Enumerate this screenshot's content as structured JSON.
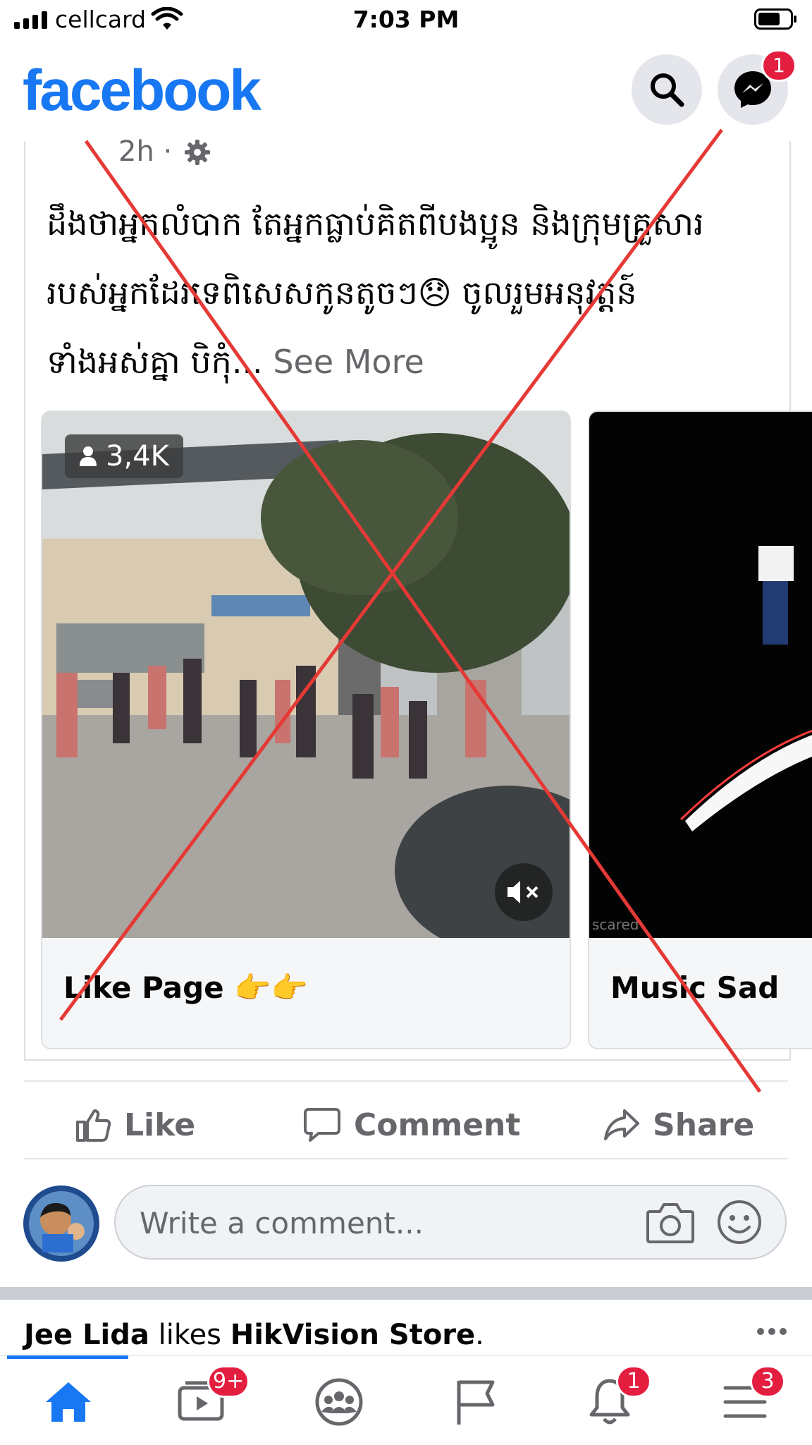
{
  "status_bar": {
    "carrier": "cellcard",
    "time": "7:03 PM"
  },
  "header": {
    "logo": "facebook",
    "messenger_badge": "1"
  },
  "post": {
    "time": "2h ·",
    "text_lines": [
      "ដឹងថាអ្នកលំបាក តែអ្នកធ្លាប់គិតពីបងប្អូន និងក្រុមគ្រួសារ",
      "របស់អ្នកដែរទេពិសេសកូនតូចៗ😞 ចូលរួមអនុវត្តន៍",
      "ទាំងអស់គ្នា បិកុំ..."
    ],
    "see_more": "See More",
    "carousel": [
      {
        "viewers": "3,4K",
        "caption": "Like Page 👉👉"
      },
      {
        "watermark": "scared",
        "caption": "Music Sad"
      }
    ]
  },
  "actions": {
    "like": "Like",
    "comment": "Comment",
    "share": "Share"
  },
  "composer": {
    "placeholder": "Write a comment..."
  },
  "next_story": {
    "actor": "Jee Lida",
    "verb": " likes ",
    "page": "HikVision Store",
    "end": "."
  },
  "tabs": {
    "watch_badge": "9+",
    "notifications_badge": "1",
    "menu_badge": "3"
  },
  "colors": {
    "brand": "#1877f2",
    "badge": "#e41e3f",
    "overlay_x": "#e53935"
  }
}
